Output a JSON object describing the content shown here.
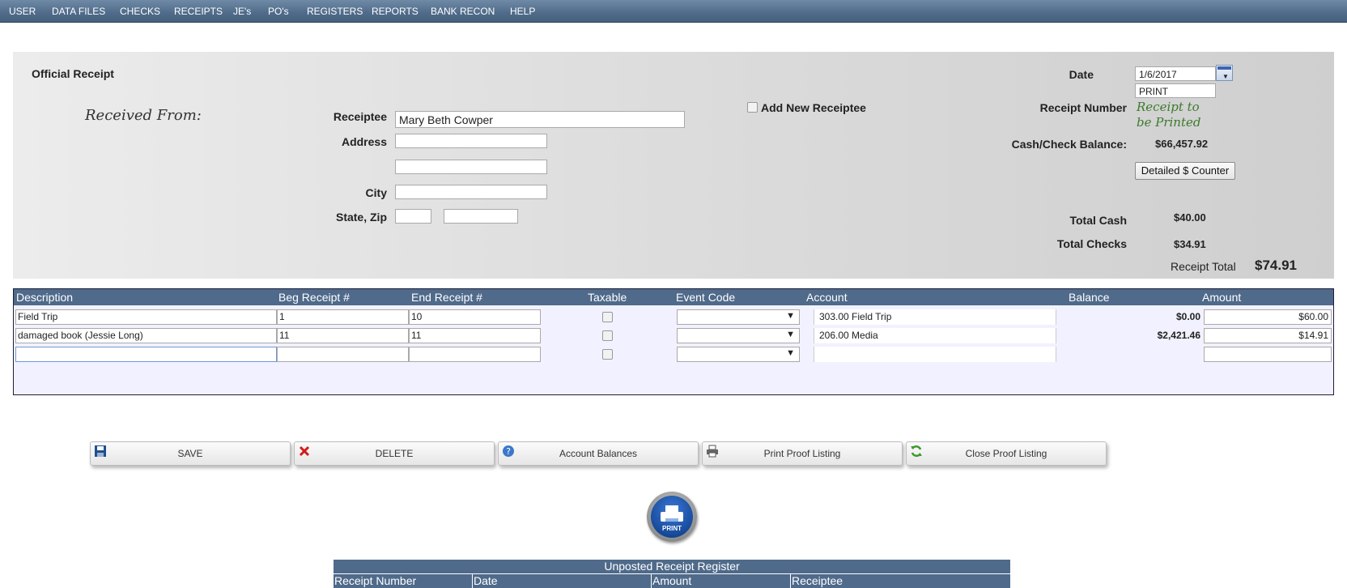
{
  "menu": [
    "USER",
    "DATA FILES",
    "CHECKS",
    "RECEIPTS",
    "JE's",
    "PO's",
    "REGISTERS",
    "REPORTS",
    "BANK RECON",
    "HELP"
  ],
  "header": {
    "title": "Official Receipt",
    "received_from": "Received From:",
    "receiptee_label": "Receiptee",
    "receiptee_value": "Mary Beth Cowper",
    "address_label": "Address",
    "address1": "",
    "address2": "",
    "city_label": "City",
    "city": "",
    "state_zip_label": "State, Zip",
    "state": "",
    "zip": "",
    "add_new_label": "Add New Receiptee",
    "date_label": "Date",
    "date_value": "1/6/2017",
    "print_value": "PRINT",
    "receipt_number_label": "Receipt Number",
    "receipt_number_value": "Receipt to be Printed",
    "balance_label": "Cash/Check Balance:",
    "balance_value": "$66,457.92",
    "counter_button": "Detailed $ Counter",
    "total_cash_label": "Total Cash",
    "total_cash_value": "$40.00",
    "total_checks_label": "Total Checks",
    "total_checks_value": "$34.91",
    "receipt_total_label": "Receipt Total",
    "receipt_total_value": "$74.91"
  },
  "grid": {
    "columns": [
      "Description",
      "Beg Receipt #",
      "End Receipt #",
      "Taxable",
      "Event Code",
      "Account",
      "Balance",
      "Amount"
    ],
    "rows": [
      {
        "description": "Field Trip",
        "beg": "1",
        "end": "10",
        "account": "303.00 Field Trip",
        "balance": "$0.00",
        "amount": "$60.00"
      },
      {
        "description": "damaged book (Jessie Long)",
        "beg": "11",
        "end": "11",
        "account": "206.00 Media",
        "balance": "$2,421.46",
        "amount": "$14.91"
      },
      {
        "description": "",
        "beg": "",
        "end": "",
        "account": "",
        "balance": "",
        "amount": ""
      }
    ]
  },
  "actions": {
    "save": "SAVE",
    "delete": "DELETE",
    "balances": "Account Balances",
    "print_proof": "Print Proof Listing",
    "close_proof": "Close Proof Listing"
  },
  "print_icon_label": "PRINT",
  "register": {
    "title": "Unposted Receipt Register",
    "columns": [
      "Receipt Number",
      "Date",
      "Amount",
      "Receiptee"
    ]
  },
  "colors": {
    "nav": "#4f6b89",
    "grid_header": "#4f6a8a",
    "receipt_script": "#3c7a2c"
  }
}
